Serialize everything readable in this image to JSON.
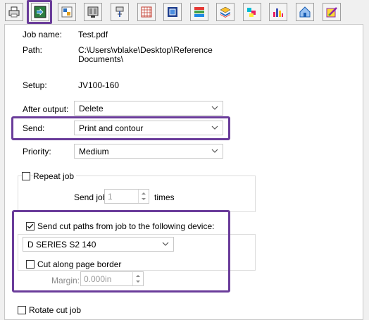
{
  "toolbar": {
    "tabs": [
      {
        "icon": "printer-settings-icon",
        "colors": [
          "#2b2b2b",
          "#6e6e6e",
          "#d8d8d8"
        ]
      },
      {
        "icon": "job-routing-icon",
        "colors": [
          "#2a7d3e",
          "#3f9ad6",
          "#1a1a1a"
        ]
      },
      {
        "icon": "color-profile-icon",
        "colors": [
          "#2a6fc0",
          "#e0a020",
          "#6a6a6a"
        ]
      },
      {
        "icon": "layout-icon",
        "colors": [
          "#3a3a3a",
          "#8c8c8c",
          "#cfcfcf"
        ]
      },
      {
        "icon": "cut-marks-icon",
        "colors": [
          "#444444",
          "#3d63b8",
          "#d9d9d9"
        ]
      },
      {
        "icon": "tiling-grid-icon",
        "colors": [
          "#c0392b",
          "#e67e22",
          "#f1c40f"
        ]
      },
      {
        "icon": "nesting-icon",
        "colors": [
          "#1f3f8f",
          "#4d8fe0",
          "#ffffff"
        ]
      },
      {
        "icon": "color-bars-icon",
        "colors": [
          "#e53935",
          "#43a047",
          "#1e88e5"
        ]
      },
      {
        "icon": "layers-stack-icon",
        "colors": [
          "#1565c0",
          "#fbc02d",
          "#e53935"
        ]
      },
      {
        "icon": "ink-channels-icon",
        "colors": [
          "#00bcd4",
          "#e91e63",
          "#ffeb3b"
        ]
      },
      {
        "icon": "bar-chart-icon",
        "colors": [
          "#e91e63",
          "#3f51b5",
          "#ffc107"
        ]
      },
      {
        "icon": "spot-color-icon",
        "colors": [
          "#1a5fb4",
          "#99c1f1",
          "#3c3c3c"
        ]
      },
      {
        "icon": "color-editor-icon",
        "colors": [
          "#8e24aa",
          "#fdd835",
          "#43a047"
        ]
      }
    ],
    "active_index": 1,
    "highlight_color": "#6a3c9a"
  },
  "job": {
    "name_label": "Job name:",
    "name_value": "Test.pdf",
    "path_label": "Path:",
    "path_line1": "C:\\Users\\vblake\\Desktop\\Reference",
    "path_line2": "Documents\\",
    "setup_label": "Setup:",
    "setup_value": "JV100-160"
  },
  "after_output": {
    "label": "After output:",
    "value": "Delete"
  },
  "send": {
    "label": "Send:",
    "value": "Print and contour"
  },
  "priority": {
    "label": "Priority:",
    "value": "Medium"
  },
  "repeat": {
    "checkbox_label": "Repeat job",
    "checked": false,
    "send_job_label": "Send job",
    "count": "1",
    "times_label": "times"
  },
  "cut": {
    "checkbox_label": "Send cut paths from job to the following device:",
    "checked": true,
    "device": "D SERIES S2 140",
    "along_border_label": "Cut along page border",
    "along_border_checked": false,
    "margin_label": "Margin:",
    "margin_value": "0.000in"
  },
  "rotate": {
    "checkbox_label": "Rotate cut job",
    "checked": false
  }
}
